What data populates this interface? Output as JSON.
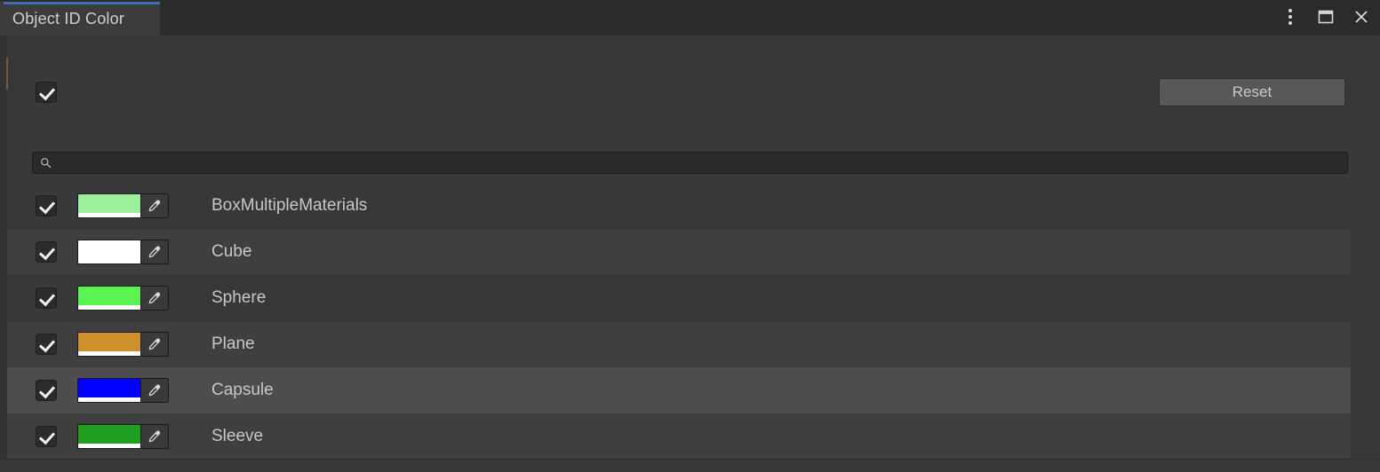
{
  "window": {
    "tab_label": "Object ID Color",
    "controls": [
      {
        "name": "more-options",
        "icon": "kebab-menu-icon"
      },
      {
        "name": "maximize",
        "icon": "maximize-icon"
      },
      {
        "name": "close",
        "icon": "close-icon"
      }
    ]
  },
  "toolbar": {
    "master_enabled": true,
    "reset_label": "Reset"
  },
  "search": {
    "value": "",
    "placeholder": "",
    "icon": "search-icon"
  },
  "colors": {
    "accent_tab": "#3f6eb5",
    "panel_bg": "#383838",
    "row_alt_bg": "#3f3f3f",
    "row_selected_bg": "#4d4d4d",
    "text": "#c6c6c6"
  },
  "list": {
    "items": [
      {
        "label": "BoxMultipleMaterials",
        "color": "#9bee9b",
        "alpha_color": "#ffffff",
        "enabled": true,
        "selected": false
      },
      {
        "label": "Cube",
        "color": "#ffffff",
        "alpha_color": "#ffffff",
        "enabled": true,
        "selected": false
      },
      {
        "label": "Sphere",
        "color": "#5bf34f",
        "alpha_color": "#ffffff",
        "enabled": true,
        "selected": false
      },
      {
        "label": "Plane",
        "color": "#ce902b",
        "alpha_color": "#ffffff",
        "enabled": true,
        "selected": false
      },
      {
        "label": "Capsule",
        "color": "#0000ff",
        "alpha_color": "#ffffff",
        "enabled": true,
        "selected": true
      },
      {
        "label": "Sleeve",
        "color": "#20a020",
        "alpha_color": "#ffffff",
        "enabled": true,
        "selected": false
      }
    ]
  }
}
